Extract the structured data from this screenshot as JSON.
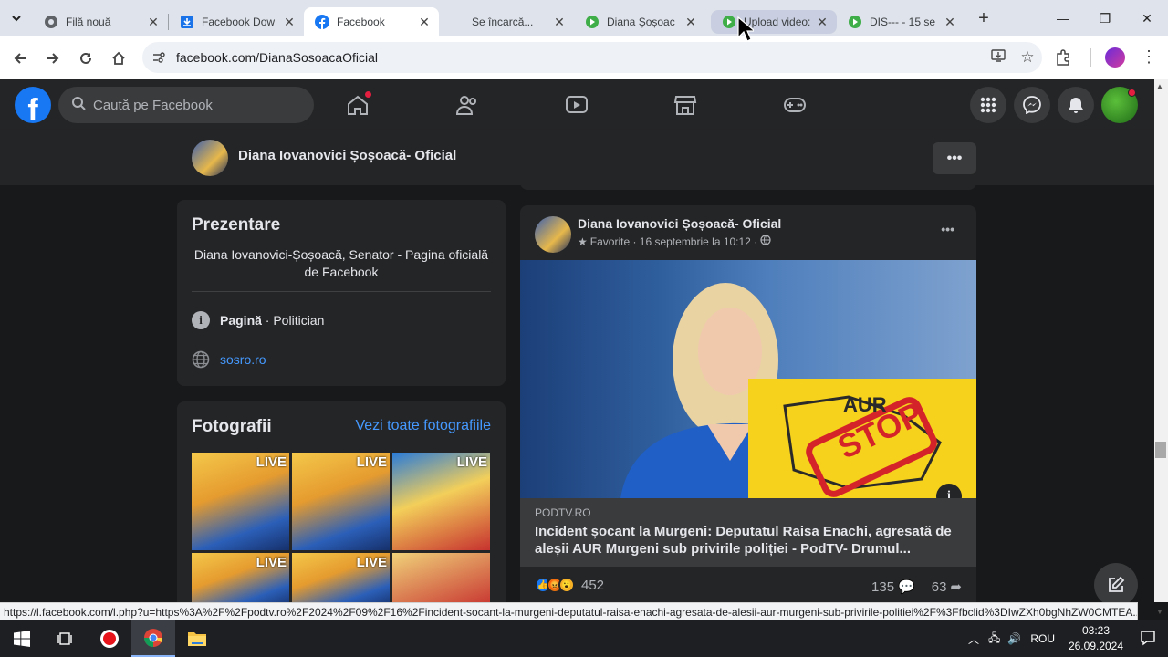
{
  "browser": {
    "tabs": [
      {
        "title": "Filă nouă",
        "icon": "chrome-icon"
      },
      {
        "title": "Facebook Dow",
        "icon": "download-icon"
      },
      {
        "title": "Facebook",
        "icon": "facebook-icon"
      },
      {
        "title": "Se încarcă...",
        "icon": ""
      },
      {
        "title": "Diana Șoșoac",
        "icon": "play-icon"
      },
      {
        "title": "Upload video:",
        "icon": "play-icon"
      },
      {
        "title": "DIS--- - 15 se",
        "icon": "play-icon"
      }
    ],
    "url": "facebook.com/DianaSosoacaOficial"
  },
  "fb": {
    "search_placeholder": "Caută pe Facebook",
    "page_name": "Diana Iovanovici Șoșoacă- Oficial"
  },
  "intro": {
    "title": "Prezentare",
    "description": "Diana Iovanovici-Șoșoacă, Senator - Pagina oficială de Facebook",
    "category_bold": "Pagină",
    "category_rest": " · Politician",
    "website": "sosro.ro"
  },
  "photos": {
    "title": "Fotografii",
    "see_all": "Vezi toate fotografiile",
    "items": [
      {
        "label": "LIVE"
      },
      {
        "label": "LIVE"
      },
      {
        "label": "LIVE"
      },
      {
        "label": "LIVE"
      },
      {
        "label": "LIVE"
      },
      {
        "label": ""
      }
    ]
  },
  "post": {
    "author": "Diana Iovanovici Șoșoacă- Oficial",
    "meta": "Favorite · 16 septembrie la 10:12 ·",
    "link_domain": "PODTV.RO",
    "link_title": "Incident șocant la Murgeni: Deputatul Raisa Enachi, agresată de aleșii AUR Murgeni sub privirile poliției - PodTV- Drumul...",
    "image_sign_text": "STOP",
    "image_logo_text": "AUR",
    "reactions_count": "452",
    "comments_count": "135",
    "shares_count": "63"
  },
  "status_url": "https://l.facebook.com/l.php?u=https%3A%2F%2Fpodtv.ro%2F2024%2F09%2F16%2Fincident-socant-la-murgeni-deputatul-raisa-enachi-agresata-de-alesii-aur-murgeni-sub-privirile-politiei%2F%3Ffbclid%3DIwZXh0bgNhZW0CMTEA...",
  "taskbar": {
    "lang": "ROU",
    "time": "03:23",
    "date": "26.09.2024"
  },
  "colors": {
    "fb_blue": "#1877f2",
    "link": "#4599ff",
    "surface": "#242526",
    "bg": "#18191a"
  }
}
